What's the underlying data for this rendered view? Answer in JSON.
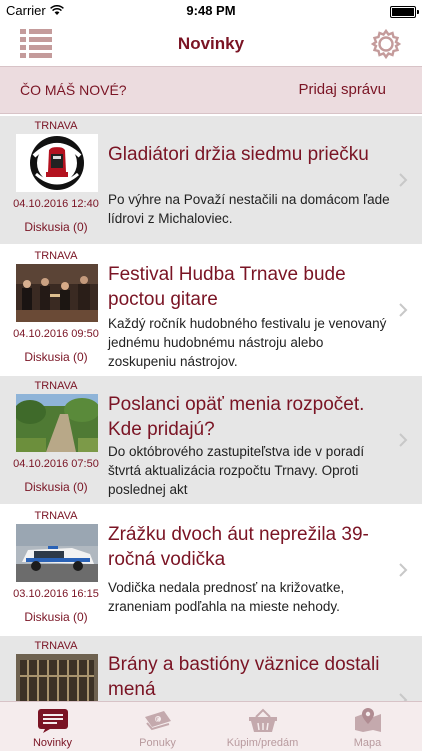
{
  "status": {
    "carrier": "Carrier",
    "time": "9:48 PM"
  },
  "header": {
    "title": "Novinky"
  },
  "actions": {
    "whats_new": "ČO MÁŠ NOVÉ?",
    "add_message": "Pridaj správu"
  },
  "articles": [
    {
      "city": "TRNAVA",
      "date": "04.10.2016 12:40",
      "discussion": "Diskusia (0)",
      "title": "Gladiátori držia siedmu priečku",
      "excerpt": "Po výhre na Považí nestačili na domácom ľade lídrovi z Michaloviec.",
      "thumb": "gladiators-logo"
    },
    {
      "city": "TRNAVA",
      "date": "04.10.2016 09:50",
      "discussion": "Diskusia (0)",
      "title": "Festival Hudba Trnave bude poctou gitare",
      "excerpt": "Každý ročník hudobného festivalu je venovaný jednému hudobnému nástroju alebo zoskupeniu nástrojov.",
      "thumb": "concert-photo"
    },
    {
      "city": "TRNAVA",
      "date": "04.10.2016 07:50",
      "discussion": "Diskusia (0)",
      "title": "Poslanci opäť menia rozpočet. Kde pridajú?",
      "excerpt": "Do októbrového zastupiteľstva ide v poradí štvrtá aktualizácia rozpočtu Trnavy. Oproti poslednej akt",
      "thumb": "park-path-photo"
    },
    {
      "city": "TRNAVA",
      "date": "03.10.2016 16:15",
      "discussion": "Diskusia (0)",
      "title": "Zrážku dvoch áut neprežila 39-ročná vodička",
      "excerpt": "Vodička nedala prednosť na križovatke, zraneniam podľahla na mieste nehody.",
      "thumb": "police-car-photo"
    },
    {
      "city": "TRNAVA",
      "date": "",
      "discussion": "",
      "title": "Brány a bastióny väznice dostali mená",
      "excerpt": "",
      "thumb": "prison-gate-photo"
    }
  ],
  "tabs": [
    {
      "label": "Novinky",
      "icon": "news-icon",
      "active": true
    },
    {
      "label": "Ponuky",
      "icon": "offers-icon",
      "active": false
    },
    {
      "label": "Kúpim/predám",
      "icon": "basket-icon",
      "active": false
    },
    {
      "label": "Mapa",
      "icon": "map-icon",
      "active": false
    }
  ],
  "colors": {
    "accent": "#7a1424",
    "muted": "#c49b9b",
    "band": "#ecdcdf"
  }
}
